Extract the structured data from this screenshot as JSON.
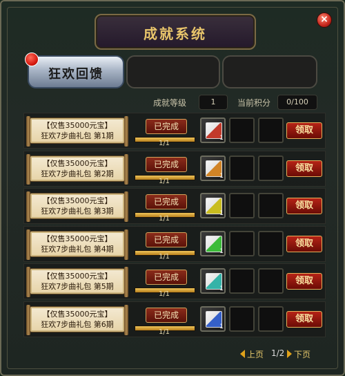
{
  "window": {
    "title": "成就系统"
  },
  "tabs": [
    {
      "label": "狂欢回馈"
    }
  ],
  "stats": {
    "level_label": "成就等级",
    "level_value": "1",
    "points_label": "当前积分",
    "points_value": "0/100"
  },
  "rows": [
    {
      "line1": "【仅售35000元宝】",
      "line2": "狂欢7步曲礼包 第1期",
      "status": "已完成",
      "progress": "1/1",
      "progress_fraction": 1,
      "item_color": "#c23a2b",
      "item_count": "1",
      "claim": "领取"
    },
    {
      "line1": "【仅售35000元宝】",
      "line2": "狂欢7步曲礼包 第2期",
      "status": "已完成",
      "progress": "1/1",
      "progress_fraction": 1,
      "item_color": "#d18426",
      "item_count": "1",
      "claim": "领取"
    },
    {
      "line1": "【仅售35000元宝】",
      "line2": "狂欢7步曲礼包 第3期",
      "status": "已完成",
      "progress": "1/1",
      "progress_fraction": 1,
      "item_color": "#c9bd1f",
      "item_count": "1",
      "claim": "领取"
    },
    {
      "line1": "【仅售35000元宝】",
      "line2": "狂欢7步曲礼包 第4期",
      "status": "已完成",
      "progress": "1/1",
      "progress_fraction": 1,
      "item_color": "#3bbb39",
      "item_count": "1",
      "claim": "领取"
    },
    {
      "line1": "【仅售35000元宝】",
      "line2": "狂欢7步曲礼包 第5期",
      "status": "已完成",
      "progress": "1/1",
      "progress_fraction": 1,
      "item_color": "#35b3a8",
      "item_count": "1",
      "claim": "领取"
    },
    {
      "line1": "【仅售35000元宝】",
      "line2": "狂欢7步曲礼包 第6期",
      "status": "已完成",
      "progress": "1/1",
      "progress_fraction": 1,
      "item_color": "#3560c9",
      "item_count": "1",
      "claim": "领取"
    }
  ],
  "pager": {
    "prev": "上页",
    "page": "1/2",
    "next": "下页"
  },
  "colors": {
    "accent_gold": "#e8c56b",
    "claim_red": "#b52316"
  },
  "icons": [
    "close-icon",
    "notification-badge-icon",
    "prev-arrow-icon",
    "next-arrow-icon",
    "gift-scroll-icon"
  ]
}
